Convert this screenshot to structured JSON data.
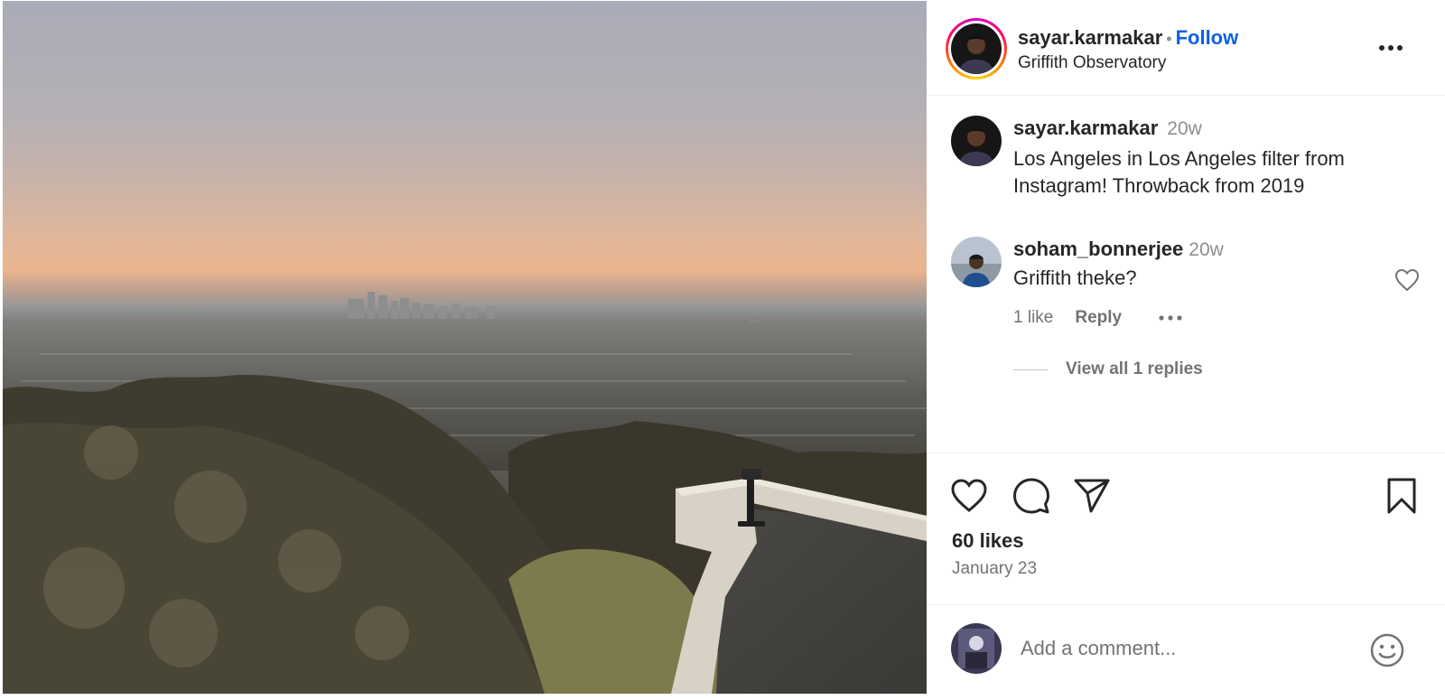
{
  "header": {
    "username": "sayar.karmakar",
    "separator": "•",
    "follow_label": "Follow",
    "location": "Griffith Observatory",
    "more_icon": "more-horizontal-icon"
  },
  "caption": {
    "username": "sayar.karmakar",
    "time": "20w",
    "text": "Los Angeles in Los Angeles filter from Instagram! Throwback from 2019"
  },
  "comment": {
    "username": "soham_bonnerjee",
    "time": "20w",
    "text": "Griffith theke?",
    "likes_label": "1 like",
    "reply_label": "Reply",
    "view_replies_label": "View all 1 replies"
  },
  "actions": {
    "icons": [
      "heart-icon",
      "comment-icon",
      "share-icon",
      "bookmark-icon"
    ],
    "likes_label": "60 likes",
    "date": "January 23"
  },
  "composer": {
    "placeholder": "Add a comment...",
    "emoji_icon": "emoji-icon"
  },
  "colors": {
    "follow_blue": "#0f5fe6",
    "text_primary": "#262626",
    "text_secondary": "#737373"
  }
}
